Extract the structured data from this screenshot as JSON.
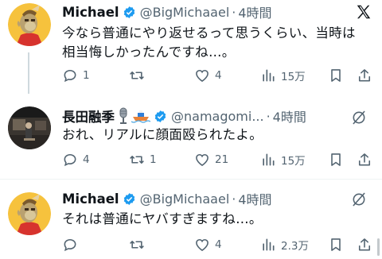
{
  "tweets": [
    {
      "name": "Michael",
      "handle": "@BigMichaael",
      "time": "4時間",
      "text_lines": [
        "今なら普通にやり返せるって思うくらい、当時は",
        "相当悔しかったんですね…。"
      ],
      "replies": "1",
      "retweets": "",
      "likes": "4",
      "views": "15万",
      "top_icon": "x-logo-icon"
    },
    {
      "name": "長田融季",
      "handle": "@namagomi...",
      "time": "4時間",
      "text_lines": [
        "おれ、リアルに顔面殴られたよ。"
      ],
      "replies": "4",
      "retweets": "1",
      "likes": "21",
      "views": "15万",
      "top_icon": "grok-icon"
    },
    {
      "name": "Michael",
      "handle": "@BigMichaael",
      "time": "4時間",
      "text_lines": [
        "それは普通にヤバすぎますね…。"
      ],
      "replies": "",
      "retweets": "",
      "likes": "4",
      "views": "2.3万",
      "top_icon": "grok-icon"
    }
  ],
  "colors": {
    "verified": "#1d9bf0",
    "muted": "#536471",
    "text": "#0f1419",
    "divider": "#eff3f4"
  }
}
